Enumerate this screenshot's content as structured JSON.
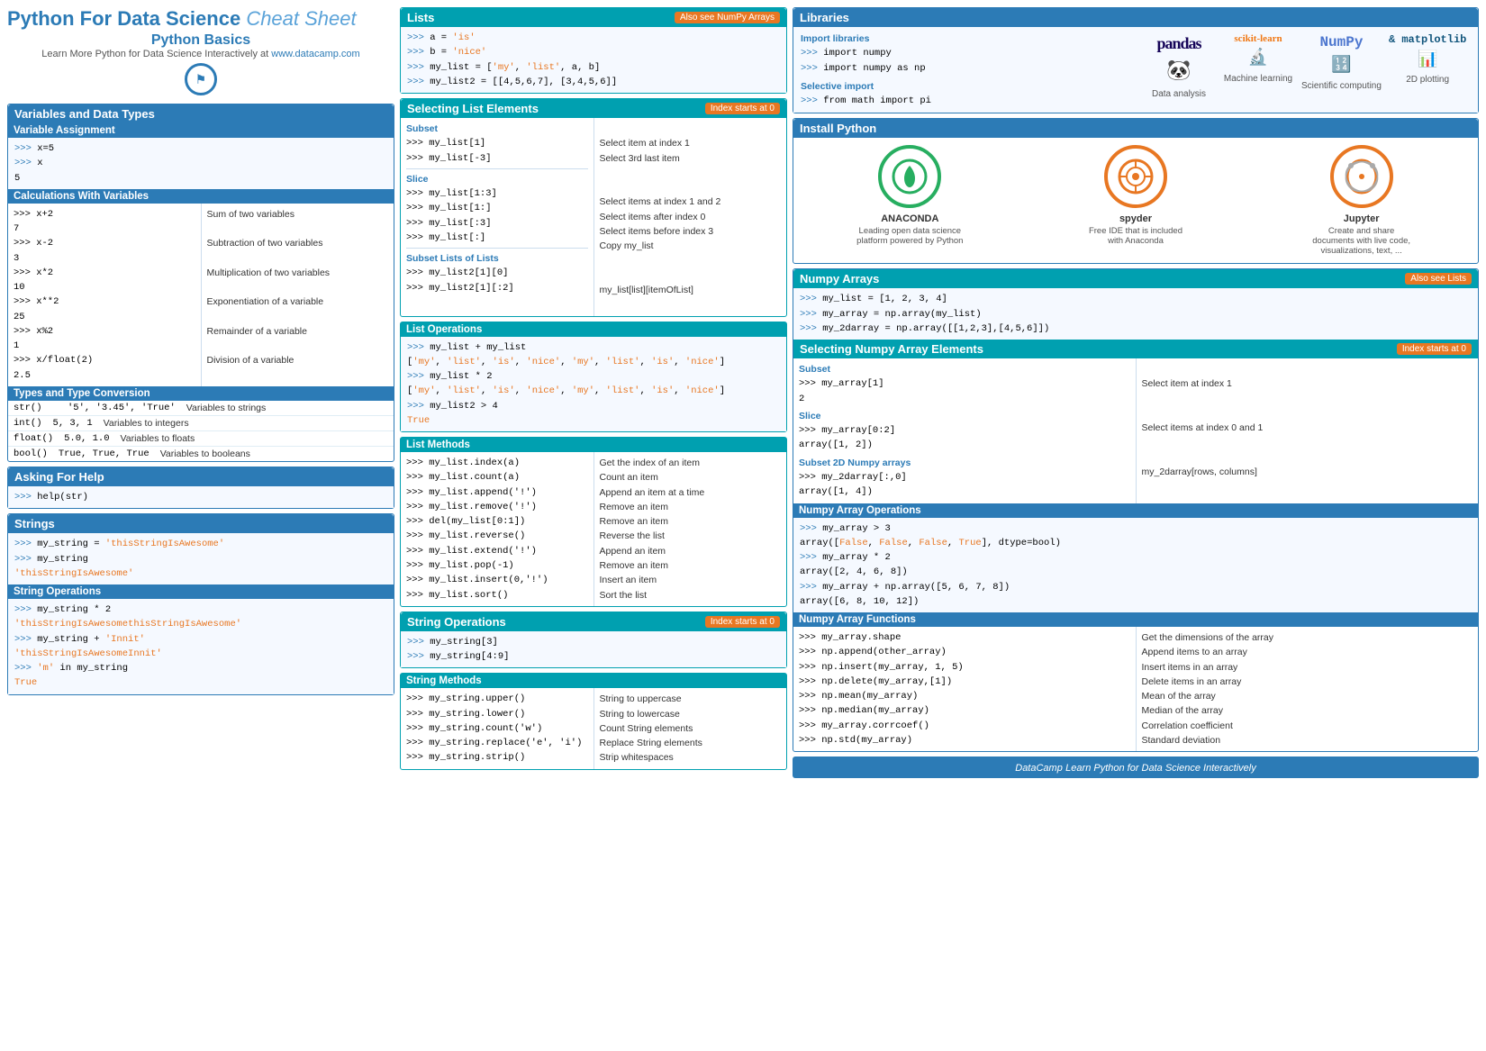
{
  "header": {
    "title_bold": "Python For Data Science",
    "title_italic": "Cheat Sheet",
    "subtitle": "Python Basics",
    "learn_text": "Learn More Python for Data Science Interactively at",
    "url": "www.datacamp.com"
  },
  "sections": {
    "variables_data_types": "Variables and Data Types",
    "variable_assignment": "Variable Assignment",
    "calculations": "Calculations With Variables",
    "types_conversion": "Types and Type Conversion",
    "asking_help": "Asking For Help",
    "strings": "Strings",
    "string_ops": "String Operations",
    "lists": "Lists",
    "selecting_list": "Selecting List Elements",
    "list_ops": "List Operations",
    "list_methods": "List Methods",
    "string_operations2": "String Operations",
    "string_methods": "String Methods",
    "libraries": "Libraries",
    "import_libraries": "Import libraries",
    "selective_import": "Selective import",
    "install_python": "Install Python",
    "numpy_arrays": "Numpy Arrays",
    "selecting_numpy": "Selecting Numpy Array Elements",
    "numpy_ops": "Numpy Array Operations",
    "numpy_funcs": "Numpy Array Functions"
  },
  "badges": {
    "also_see_numpy": "Also see NumPy Arrays",
    "also_see_lists": "Also see Lists",
    "index_starts": "Index starts at 0"
  },
  "lib_logos": [
    {
      "name": "pandas",
      "label": "Data analysis"
    },
    {
      "name": "sklearn",
      "label": "Machine learning"
    },
    {
      "name": "numpy",
      "label": "Scientific computing"
    },
    {
      "name": "matplotlib",
      "label": "2D plotting"
    }
  ],
  "install_items": [
    {
      "name": "ANACONDA",
      "desc": "Leading open data science platform powered by Python",
      "color": "#27ae60"
    },
    {
      "name": "spyder",
      "desc": "Free IDE that is included with Anaconda",
      "color": "#e87722"
    },
    {
      "name": "Jupyter",
      "desc": "Create and share documents with live code, visualizations, text, ...",
      "color": "#e87722"
    }
  ],
  "footer": {
    "brand": "DataCamp",
    "tagline": "Learn Python for Data Science Interactively"
  }
}
